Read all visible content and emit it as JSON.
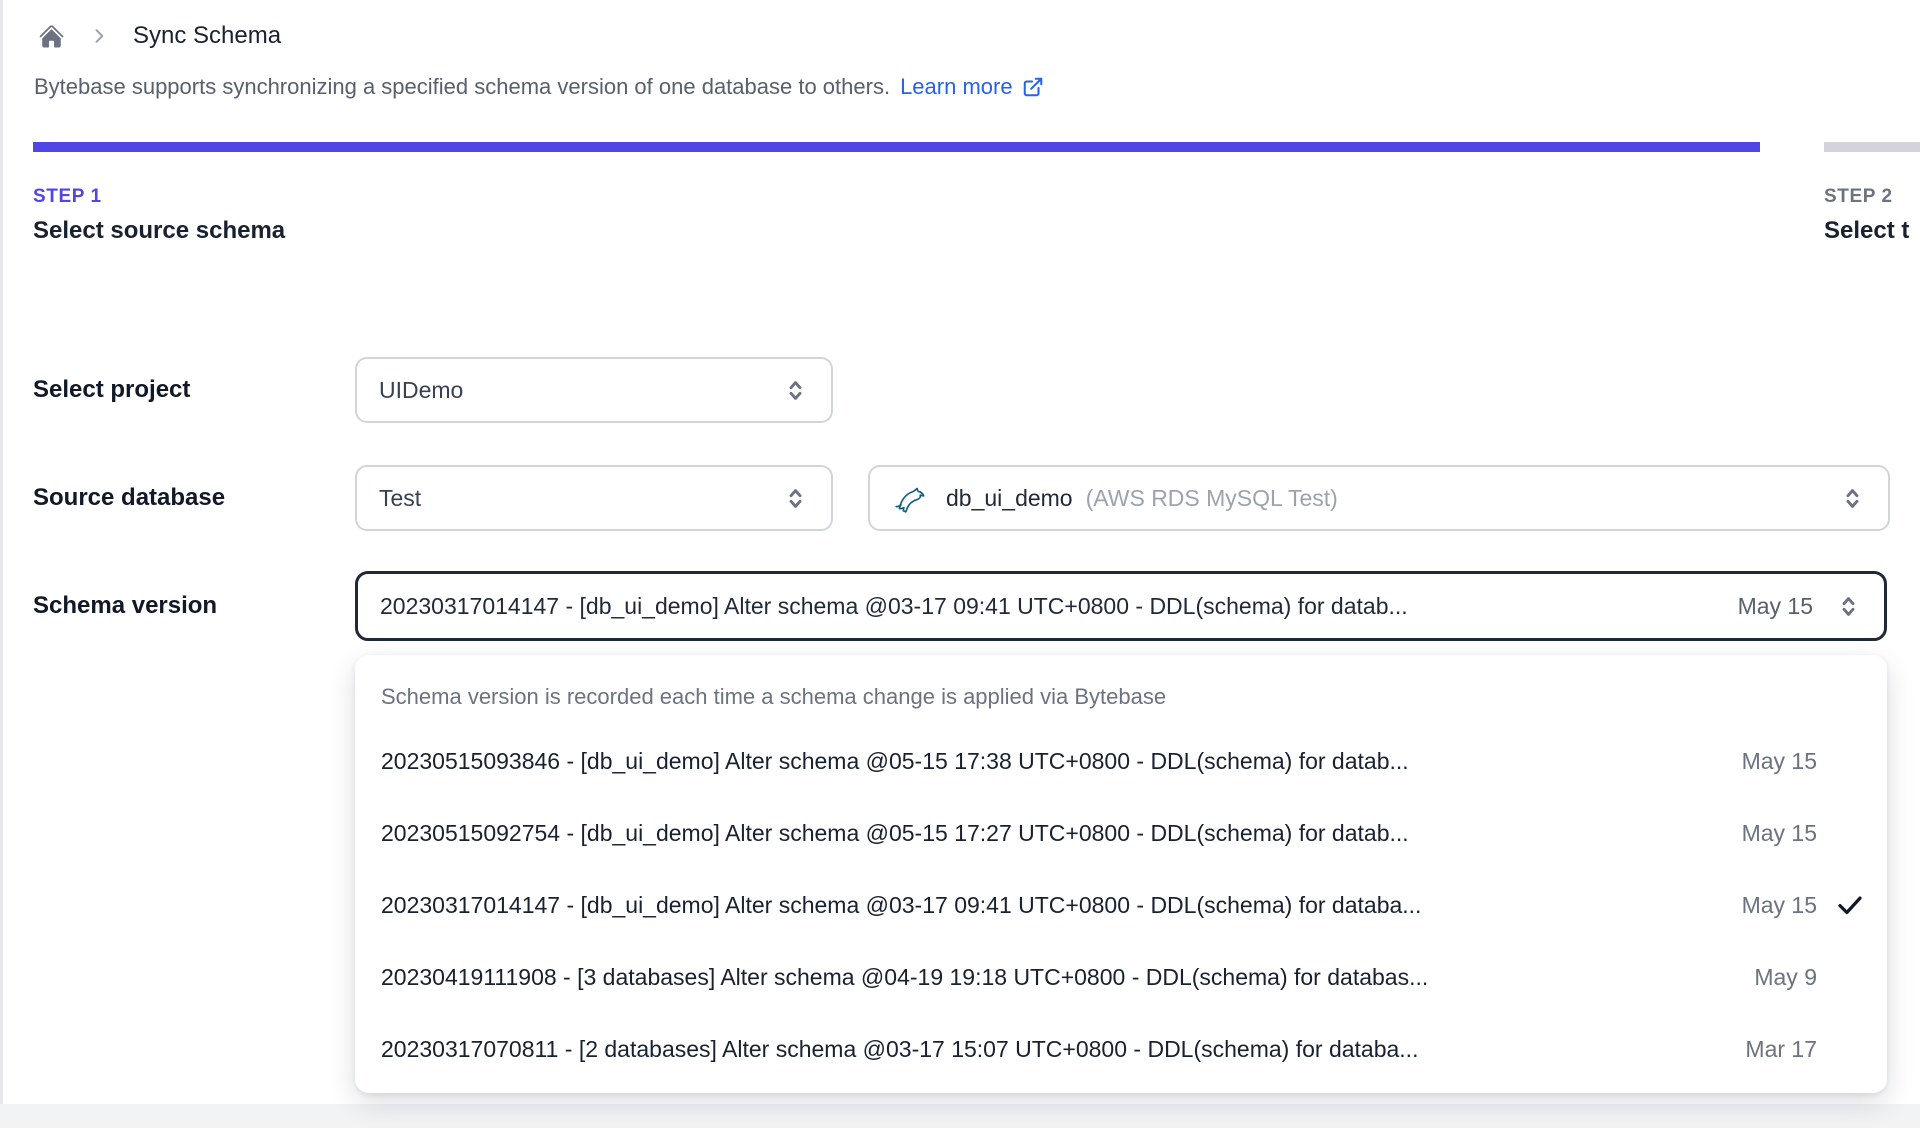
{
  "colors": {
    "accent_indigo": "#4f46e5",
    "link_blue": "#2563eb",
    "inactive_bar_gray": "#d1d5db",
    "mysql_icon_teal": "#11607e"
  },
  "breadcrumb": {
    "home_icon": "home-icon",
    "title": "Sync Schema"
  },
  "intro": {
    "text": "Bytebase supports synchronizing a specified schema version of one database to others.",
    "link_label": "Learn more",
    "link_icon": "external-link-icon"
  },
  "steps": [
    {
      "label": "STEP 1",
      "title": "Select source schema",
      "active": true
    },
    {
      "label": "STEP 2",
      "title": "Select t",
      "active": false
    }
  ],
  "form": {
    "project": {
      "label": "Select project",
      "value": "UIDemo"
    },
    "source_database": {
      "label": "Source database",
      "environment_value": "Test",
      "database_value": "db_ui_demo",
      "database_detail": "(AWS RDS MySQL Test)",
      "database_icon": "mysql-icon"
    },
    "schema_version": {
      "label": "Schema version",
      "selected_text": "20230317014147 - [db_ui_demo] Alter schema @03-17 09:41 UTC+0800 - DDL(schema) for datab...",
      "selected_date": "May 15"
    }
  },
  "dropdown": {
    "header": "Schema version is recorded each time a schema change is applied via Bytebase",
    "options": [
      {
        "text": "20230515093846 - [db_ui_demo] Alter schema @05-15 17:38 UTC+0800 - DDL(schema) for datab...",
        "date": "May 15",
        "selected": false
      },
      {
        "text": "20230515092754 - [db_ui_demo] Alter schema @05-15 17:27 UTC+0800 - DDL(schema) for datab...",
        "date": "May 15",
        "selected": false
      },
      {
        "text": "20230317014147 - [db_ui_demo] Alter schema @03-17 09:41 UTC+0800 - DDL(schema) for databa...",
        "date": "May 15",
        "selected": true
      },
      {
        "text": "20230419111908 - [3 databases] Alter schema @04-19 19:18 UTC+0800 - DDL(schema) for databas...",
        "date": "May 9",
        "selected": false
      },
      {
        "text": "20230317070811 - [2 databases] Alter schema @03-17 15:07 UTC+0800 - DDL(schema) for databa...",
        "date": "Mar 17",
        "selected": false
      }
    ]
  }
}
